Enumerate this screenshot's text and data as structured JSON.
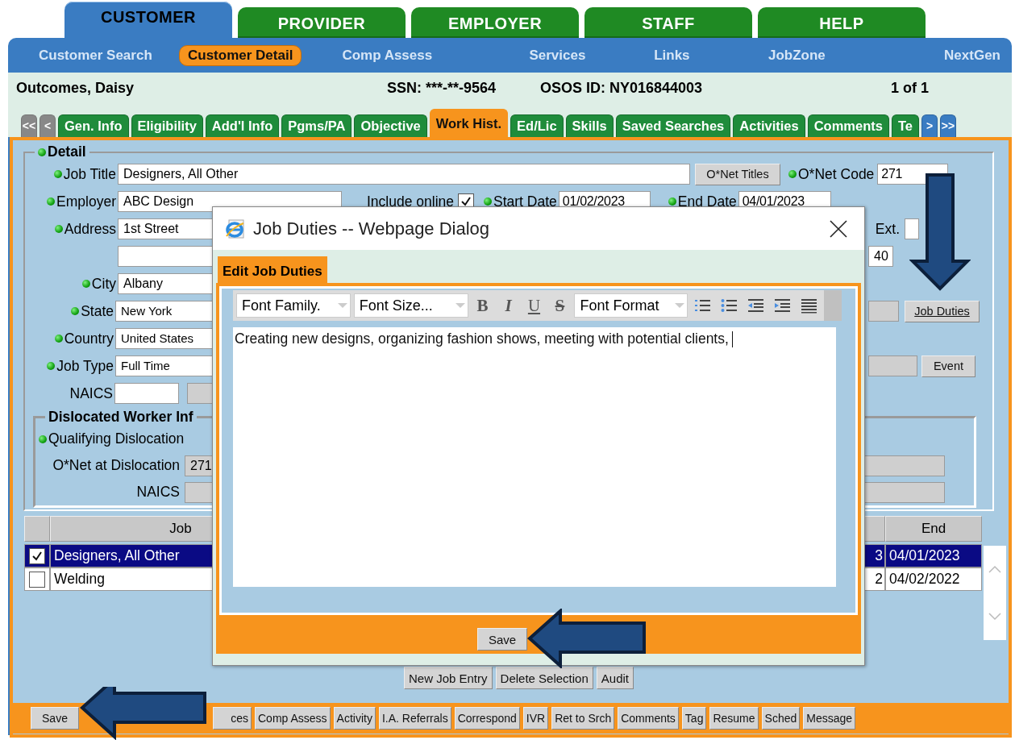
{
  "top_tabs": [
    {
      "label": "CUSTOMER",
      "selected": true
    },
    {
      "label": "PROVIDER",
      "selected": false
    },
    {
      "label": "EMPLOYER",
      "selected": false
    },
    {
      "label": "STAFF",
      "selected": false
    },
    {
      "label": "HELP",
      "selected": false
    }
  ],
  "nav_links": [
    {
      "label": "Customer Search",
      "selected": false
    },
    {
      "label": "Customer Detail",
      "selected": true
    },
    {
      "label": "Comp Assess",
      "selected": false
    },
    {
      "label": "Services",
      "selected": false
    },
    {
      "label": "Links",
      "selected": false
    },
    {
      "label": "JobZone",
      "selected": false
    },
    {
      "label": "NextGen",
      "selected": false
    }
  ],
  "customer_bar": {
    "name": "Outcomes, Daisy",
    "ssn": "SSN: ***-**-9564",
    "osos_id": "OSOS ID: NY016844003",
    "record_count": "1 of 1"
  },
  "subtabs": {
    "scroll_left": [
      "<<",
      "<"
    ],
    "items": [
      {
        "label": "Gen. Info",
        "selected": false
      },
      {
        "label": "Eligibility",
        "selected": false
      },
      {
        "label": "Add'l Info",
        "selected": false
      },
      {
        "label": "Pgms/PA",
        "selected": false
      },
      {
        "label": "Objective",
        "selected": false
      },
      {
        "label": "Work Hist.",
        "selected": true
      },
      {
        "label": "Ed/Lic",
        "selected": false
      },
      {
        "label": "Skills",
        "selected": false
      },
      {
        "label": "Saved Searches",
        "selected": false
      },
      {
        "label": "Activities",
        "selected": false
      },
      {
        "label": "Comments",
        "selected": false
      },
      {
        "label": "Te",
        "selected": false
      }
    ],
    "scroll_right": [
      ">",
      ">>"
    ]
  },
  "detail": {
    "legend": {
      "label": "Detail",
      "required": true
    },
    "job_title": {
      "label": "Job Title",
      "required": true,
      "value": "Designers, All Other"
    },
    "onet_titles_button": "O*Net Titles",
    "onet_code": {
      "label": "O*Net Code",
      "required": true,
      "value": "271"
    },
    "employer": {
      "label": "Employer",
      "required": true,
      "value": "ABC  Design"
    },
    "include_online": {
      "label": "Include online",
      "checked": true
    },
    "start_date": {
      "label": "Start Date",
      "required": true,
      "value": "01/02/2023"
    },
    "end_date": {
      "label": "End Date",
      "required": true,
      "value": "04/01/2023"
    },
    "address": {
      "label": "Address",
      "required": true,
      "value": "1st Street"
    },
    "ext": {
      "label": "Ext."
    },
    "unlabeled_field": {
      "value": "40"
    },
    "city": {
      "label": "City",
      "required": true,
      "value": "Albany"
    },
    "state": {
      "label": "State",
      "required": true,
      "value": "New York"
    },
    "job_duties_button": "Job Duties",
    "country": {
      "label": "Country",
      "required": true,
      "value": "United States"
    },
    "job_type": {
      "label": "Job Type",
      "required": true,
      "value": "Full Time"
    },
    "event_button": "Event",
    "naics": {
      "label": "NAICS"
    },
    "dislocated": {
      "legend": "Dislocated Worker Inf",
      "qualifying": {
        "label": "Qualifying Dislocation",
        "required": true
      },
      "onet": {
        "label": "O*Net at Dislocation",
        "value": "271"
      },
      "naics": {
        "label": "NAICS"
      }
    }
  },
  "table": {
    "columns": [
      {
        "label": "Job"
      },
      {
        "label": "End"
      }
    ],
    "rows": [
      {
        "checked": true,
        "selected": true,
        "job": "Designers, All Other",
        "column_3": "3",
        "end": "04/01/2023"
      },
      {
        "checked": false,
        "selected": false,
        "job": "Welding",
        "column_3": "2",
        "end": "04/02/2022"
      }
    ]
  },
  "list_buttons": [
    "New Job Entry",
    "Delete Selection",
    "Audit"
  ],
  "toolbar_buttons": [
    "Save",
    "ces",
    "Comp Assess",
    "Activity",
    "I.A. Referrals",
    "Correspond",
    "IVR",
    "Ret to Srch",
    "Comments",
    "Tag",
    "Resume",
    "Sched",
    "Message"
  ],
  "dialog": {
    "title": "Job Duties -- Webpage Dialog",
    "tab": "Edit Job Duties",
    "toolbar": [
      {
        "kind": "select",
        "label": "Font Family."
      },
      {
        "kind": "select",
        "label": "Font Size..."
      },
      {
        "kind": "format",
        "label": "B"
      },
      {
        "kind": "format",
        "label": "I"
      },
      {
        "kind": "format",
        "label": "U"
      },
      {
        "kind": "format",
        "label": "S"
      },
      {
        "kind": "select",
        "label": "Font Format"
      },
      {
        "kind": "numbered_list"
      },
      {
        "kind": "bullet_list"
      },
      {
        "kind": "outdent"
      },
      {
        "kind": "indent"
      },
      {
        "kind": "justify"
      }
    ],
    "content": "Creating new designs, organizing fashion shows, meeting with potential clients,",
    "save_button": "Save"
  }
}
